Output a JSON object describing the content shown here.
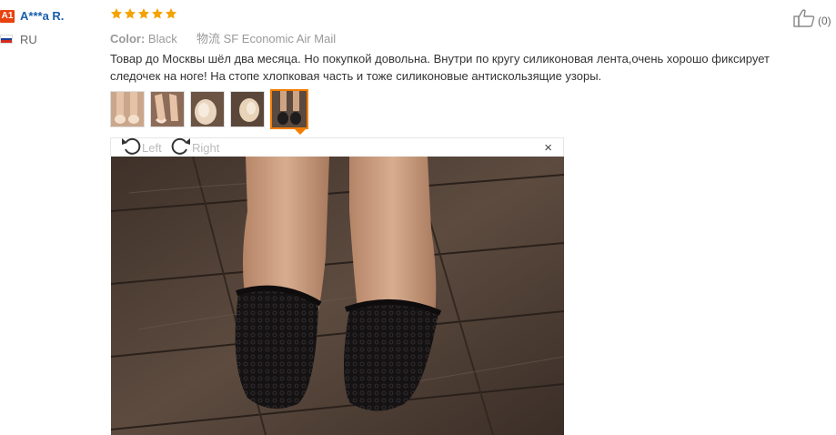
{
  "reviewer": {
    "badge": "A1",
    "name": "A***a R.",
    "country": "RU"
  },
  "rating": {
    "stars": 5,
    "max": 5,
    "color": "#f4a300"
  },
  "helpful": {
    "count": "(0)"
  },
  "meta": {
    "color_label": "Color:",
    "color_value": "Black",
    "shipping": "物流 SF Economic Air Mail"
  },
  "review_text": "Товар до Москвы шёл два месяца. Но покупкой довольна. Внутри по кругу силиконовая лента,очень хорошо фиксирует следочек на ноге! На стопе хлопковая часть и тоже силиконовые антискользящие узоры.",
  "thumbnails": {
    "count": 5,
    "active_index": 5,
    "accent": "#f47d00"
  },
  "viewer": {
    "rotate_left": "Left",
    "rotate_right": "Right",
    "close": "×"
  }
}
